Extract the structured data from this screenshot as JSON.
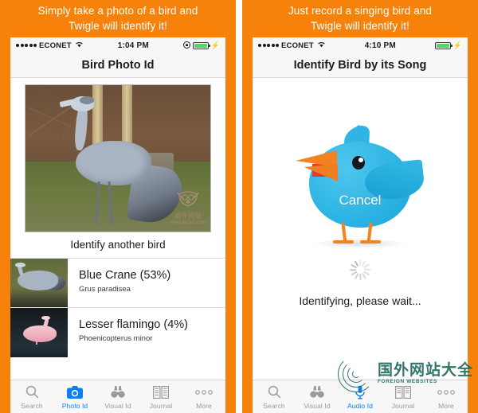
{
  "theme": {
    "orange": "#f7820b",
    "accent_blue": "#0d7ff2",
    "bird_blue": "#2fb5e4",
    "beak_orange": "#f58220",
    "watermark_teal": "#1f6b5e"
  },
  "panels": [
    {
      "promo_line1": "Simply take a photo of a bird and",
      "promo_line2": "Twigle will identify it!",
      "status": {
        "carrier": "ECONET",
        "signal_dots": 5,
        "wifi_icon": "wifi-icon",
        "time": "1:04 PM",
        "lock_icon": "rotation-lock-icon",
        "battery_icon": "battery-icon",
        "charging_icon": "lightning-bolt-icon"
      },
      "nav_title": "Bird Photo Id",
      "hero": {
        "image_alt": "Blue Crane standing on grass",
        "watermark_owl": "owl-watermark-icon",
        "watermark_line1": "国外网站",
        "watermark_line2": "www.egouz.com"
      },
      "identify_again": "Identify another bird",
      "results": [
        {
          "name": "Blue Crane (53%)",
          "latin": "Grus paradisea",
          "thumb": "blue-crane-thumbnail"
        },
        {
          "name": "Lesser flamingo (4%)",
          "latin": "Phoenicopterus minor",
          "thumb": "lesser-flamingo-thumbnail"
        }
      ],
      "tabs": [
        {
          "label": "Search",
          "icon": "search-icon",
          "active": false
        },
        {
          "label": "Photo Id",
          "icon": "camera-icon",
          "active": true
        },
        {
          "label": "Visual Id",
          "icon": "binoculars-icon",
          "active": false
        },
        {
          "label": "Journal",
          "icon": "open-book-icon",
          "active": false
        },
        {
          "label": "More",
          "icon": "ellipsis-icon",
          "active": false
        }
      ]
    },
    {
      "promo_line1": "Just record a singing bird and",
      "promo_line2": "Twigle will identify it!",
      "status": {
        "carrier": "ECONET",
        "signal_dots": 5,
        "wifi_icon": "wifi-icon",
        "time": "4:10 PM",
        "lock_icon": "",
        "battery_icon": "battery-icon",
        "charging_icon": "lightning-bolt-icon"
      },
      "nav_title": "Identify Bird by its Song",
      "bird_art_alt": "singing blue cartoon bird",
      "cancel_label": "Cancel",
      "spinner_icon": "loading-spinner-icon",
      "wait_text": "Identifying, please wait...",
      "tabs": [
        {
          "label": "Search",
          "icon": "search-icon",
          "active": false
        },
        {
          "label": "Visual Id",
          "icon": "binoculars-icon",
          "active": false
        },
        {
          "label": "Audio Id",
          "icon": "microphone-icon",
          "active": true
        },
        {
          "label": "Journal",
          "icon": "open-book-icon",
          "active": false
        },
        {
          "label": "More",
          "icon": "ellipsis-icon",
          "active": false
        }
      ],
      "watermark": {
        "logo_icon": "swirl-rings-logo-icon",
        "cn": "国外网站大全",
        "en": "FOREIGN WEBSITES"
      }
    }
  ]
}
